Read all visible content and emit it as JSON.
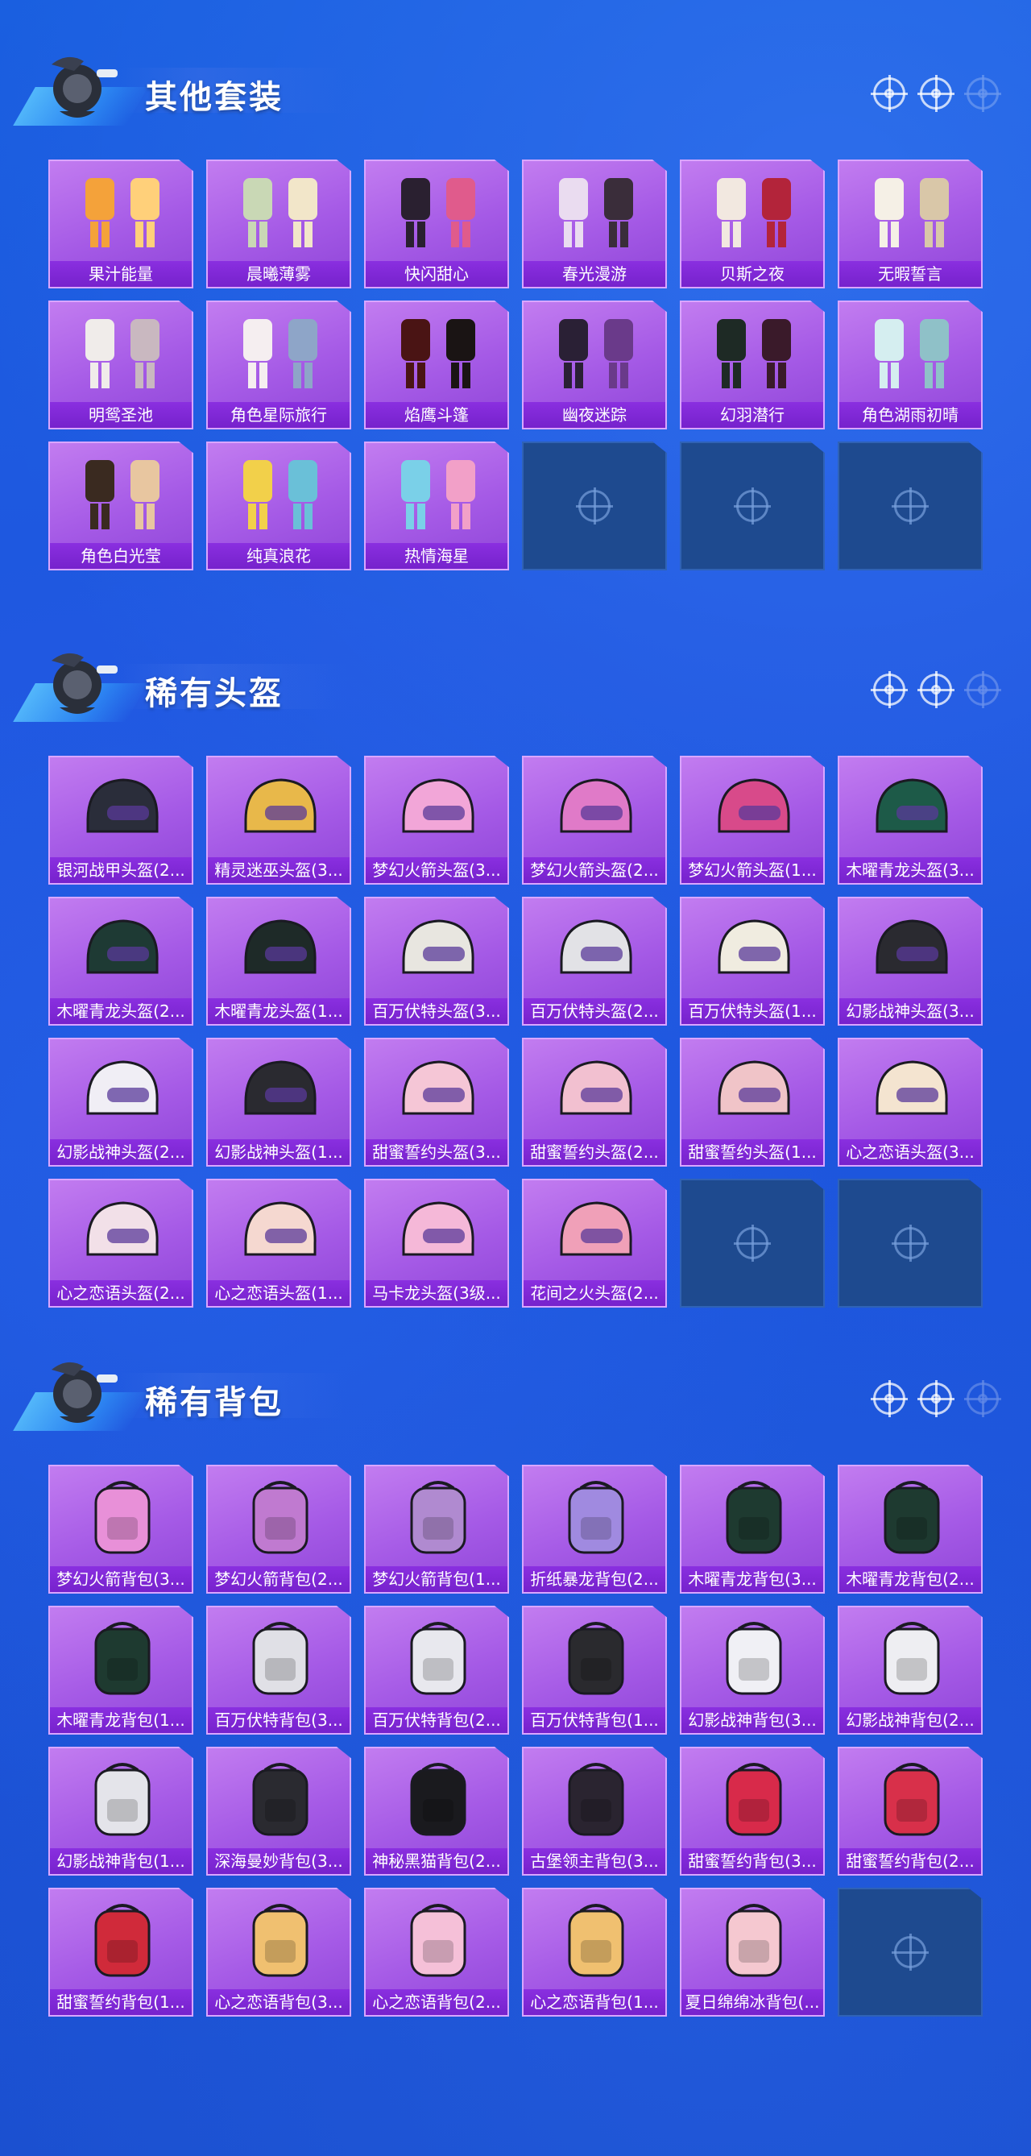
{
  "sections": [
    {
      "title": "其他套装",
      "kind": "outfit",
      "items": [
        "果汁能量",
        "晨曦薄雾",
        "快闪甜心",
        "春光漫游",
        "贝斯之夜",
        "无暇誓言",
        "明鸳圣池",
        "角色星际旅行",
        "焰鹰斗篷",
        "幽夜迷踪",
        "幻羽潜行",
        "角色湖雨初晴",
        "角色白光莹",
        "纯真浪花",
        "热情海星"
      ],
      "empty_slots": 3
    },
    {
      "title": "稀有头盔",
      "kind": "helmet",
      "items": [
        "银河战甲头盔(2...",
        "精灵迷巫头盔(3...",
        "梦幻火箭头盔(3...",
        "梦幻火箭头盔(2...",
        "梦幻火箭头盔(1...",
        "木曜青龙头盔(3...",
        "木曜青龙头盔(2...",
        "木曜青龙头盔(1...",
        "百万伏特头盔(3...",
        "百万伏特头盔(2...",
        "百万伏特头盔(1...",
        "幻影战神头盔(3...",
        "幻影战神头盔(2...",
        "幻影战神头盔(1...",
        "甜蜜誓约头盔(3...",
        "甜蜜誓约头盔(2...",
        "甜蜜誓约头盔(1...",
        "心之恋语头盔(3...",
        "心之恋语头盔(2...",
        "心之恋语头盔(1...",
        "马卡龙头盔(3级...",
        "花间之火头盔(2..."
      ],
      "empty_slots": 2
    },
    {
      "title": "稀有背包",
      "kind": "backpack",
      "items": [
        "梦幻火箭背包(3...",
        "梦幻火箭背包(2...",
        "梦幻火箭背包(1...",
        "折纸暴龙背包(2...",
        "木曜青龙背包(3...",
        "木曜青龙背包(2...",
        "木曜青龙背包(1...",
        "百万伏特背包(3...",
        "百万伏特背包(2...",
        "百万伏特背包(1...",
        "幻影战神背包(3...",
        "幻影战神背包(2...",
        "幻影战神背包(1...",
        "深海曼妙背包(3...",
        "神秘黑猫背包(2...",
        "古堡领主背包(3...",
        "甜蜜誓约背包(3...",
        "甜蜜誓约背包(2...",
        "甜蜜誓约背包(1...",
        "心之恋语背包(3...",
        "心之恋语背包(2...",
        "心之恋语背包(1...",
        "夏日绵绵冰背包(..."
      ],
      "empty_slots": 1
    }
  ],
  "colors": {
    "card_bg": "#a55ae6",
    "label_bg": "#7622cc",
    "empty_bg": "#1e4a8f",
    "page_bg": "#1c55dc"
  }
}
